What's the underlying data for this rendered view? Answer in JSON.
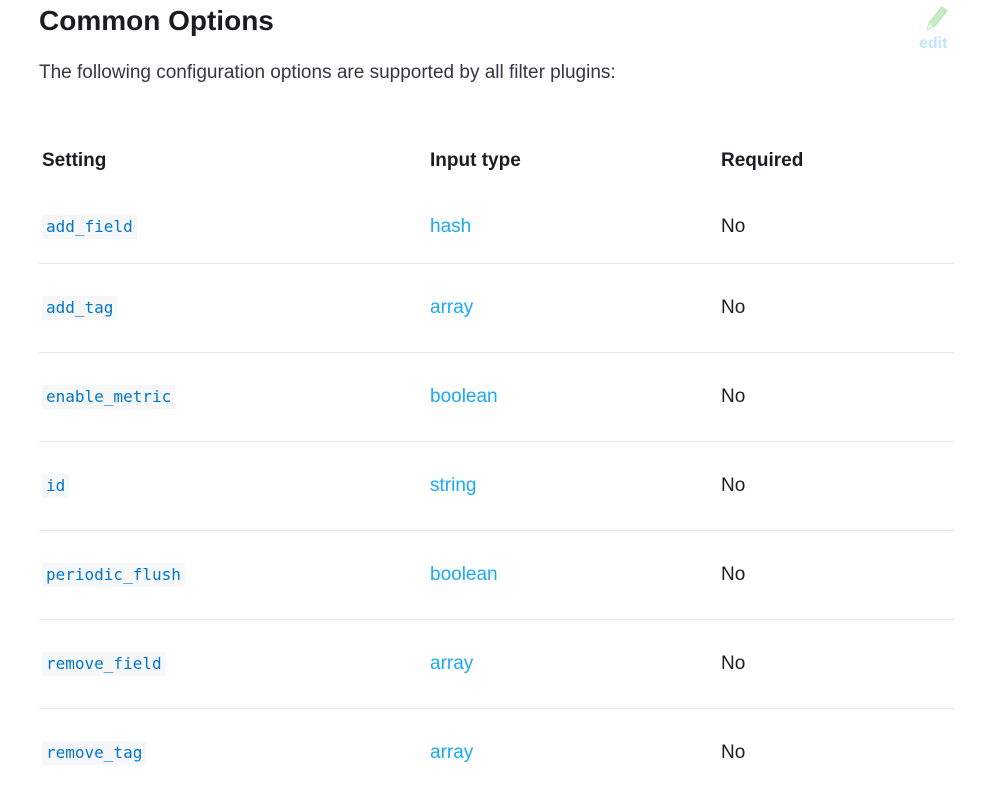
{
  "header": {
    "title": "Common Options",
    "edit_label": "edit",
    "edit_icon": "pencil-icon",
    "edit_color": "#bfe6f5"
  },
  "intro": "The following configuration options are supported by all filter plugins:",
  "table": {
    "headers": [
      "Setting",
      "Input type",
      "Required"
    ],
    "rows": [
      {
        "setting": "add_field",
        "type": "hash",
        "required": "No"
      },
      {
        "setting": "add_tag",
        "type": "array",
        "required": "No"
      },
      {
        "setting": "enable_metric",
        "type": "boolean",
        "required": "No"
      },
      {
        "setting": "id",
        "type": "string",
        "required": "No"
      },
      {
        "setting": "periodic_flush",
        "type": "boolean",
        "required": "No"
      },
      {
        "setting": "remove_field",
        "type": "array",
        "required": "No"
      },
      {
        "setting": "remove_tag",
        "type": "array",
        "required": "No"
      }
    ]
  },
  "colors": {
    "link": "#1ba9f5",
    "code": "#0077cc",
    "code_bg": "#f6f7f9",
    "divider": "#e3e6ec",
    "text": "#1a1c21"
  }
}
